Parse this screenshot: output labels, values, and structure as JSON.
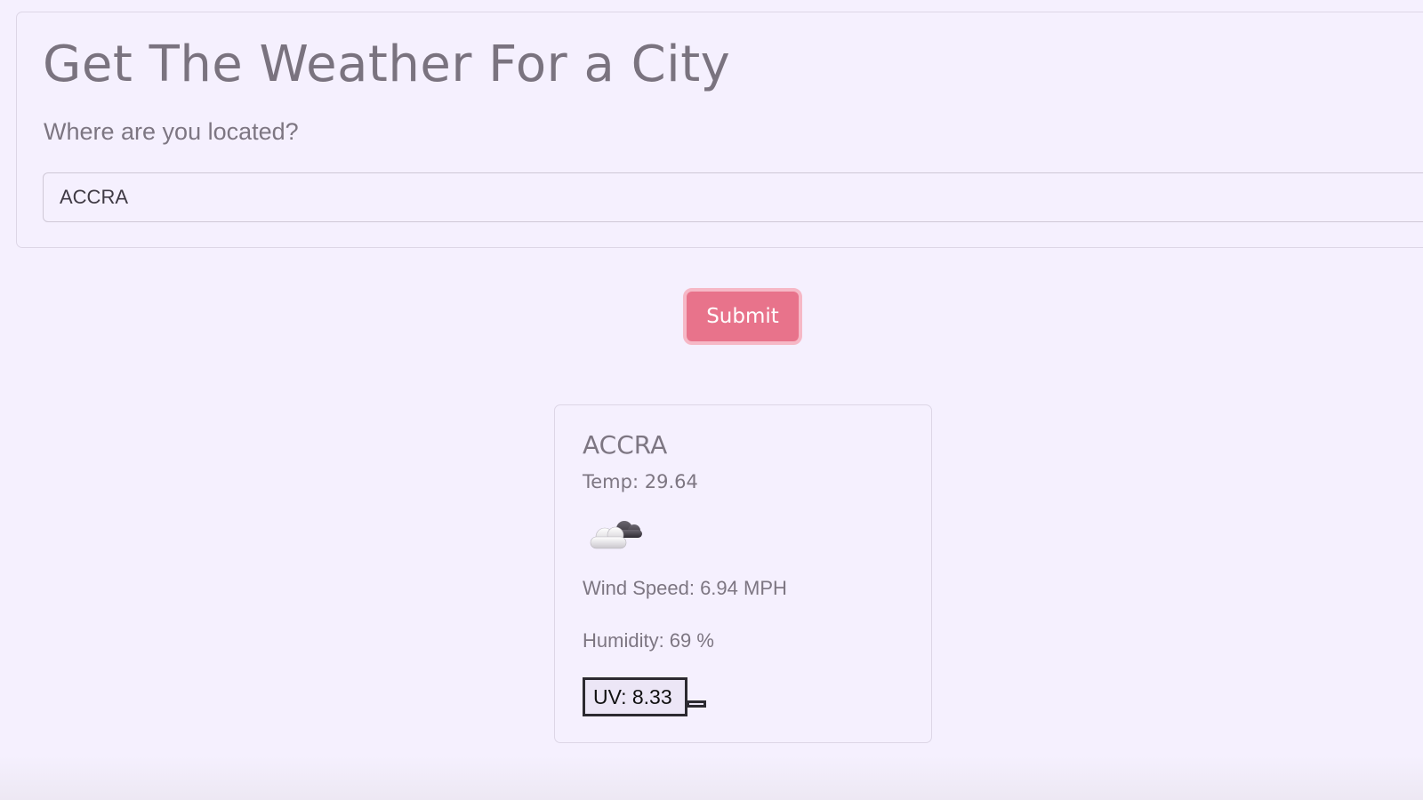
{
  "header": {
    "title": "Get The Weather For a City",
    "prompt": "Where are you located?"
  },
  "search": {
    "value": "ACCRA",
    "placeholder": ""
  },
  "submit": {
    "label": "Submit",
    "color": "#e8738b"
  },
  "weather_card": {
    "city": "ACCRA",
    "temp": "Temp: 29.64",
    "icon": "partly-cloudy-icon",
    "wind_speed": "Wind Speed: 6.94 MPH",
    "humidity": "Humidity: 69 %",
    "uv": "UV: 8.33"
  },
  "colors": {
    "background": "#f5f0fe",
    "text": "#7d7682",
    "border": "#ddd6e6"
  }
}
